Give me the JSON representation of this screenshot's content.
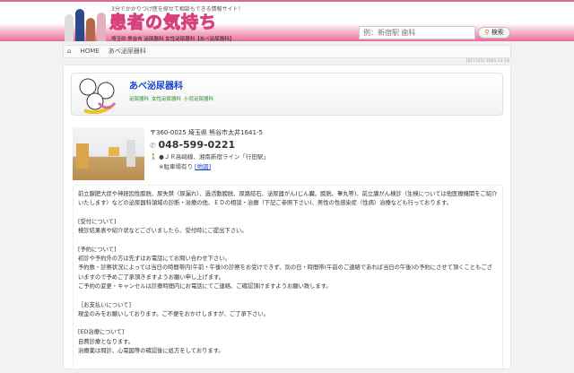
{
  "header": {
    "tagline": "3分でかかりつけ医を探せて相談もできる情報サイト！",
    "logo": "患者の気持ち",
    "subtitle": "埼玉県 熊谷市 泌尿器科 女性泌尿器科【あべ泌尿器科】",
    "search_placeholder": "例：新宿駅 歯科",
    "search_button": "検索"
  },
  "breadcrumb": {
    "home": "HOME",
    "current": "あべ泌尿器科"
  },
  "meta": {
    "date": "[017725] 2025-12-18"
  },
  "clinic": {
    "name": "あべ泌尿器科",
    "tags": [
      "泌尿器科",
      "女性泌尿器科",
      "小児泌尿器科"
    ],
    "address": "〒360-0025 埼玉県 熊谷市太井1641-5",
    "phone": "048-599-0221",
    "access": "●ＪＲ高崎線、湘南新宿ライン「行田駅」",
    "parking": "※駐車場有り",
    "map_link": "[地図]"
  },
  "description": [
    "前立腺肥大症や神経因性膀胱、尿失禁（尿漏れ）、過活動膀胱、尿路結石、泌尿器がん(じん臓、膀胱、睾丸等)、前立腺がん検診（生検については他医療機関をご紹介いたします）などの泌尿器科領域の診断・治療の他、ＥＤの相談・治療（下記ご参照下さい)、男性の性感染症（性病）治療なども行っております。",
    "[受付について]\n検診結果表や紹介状などございましたら、受付時にご提出下さい。",
    "[予約について]\n初診や予約外の方は先ずはお電話にてお問い合わせ下さい。\n予約数・診察状況によっては当日の時間帯内(午前・午後)の診察をお受けできず、別の日・時間帯(午前のご連絡であれば当日の午後)の予約にさせて頂くこともございますので予めご了承頂きますようお願い申し上げます。\nご予約の変更・キャンセルは診療時間内にお電話にてご連絡、ご確認頂けますようお願い致します。",
    "［お支払いについて]\n現金のみをお願いしております。ご不便をおかけしますが、ご了承下さい。",
    "[ED治療について]\n自費診療となります。\n治療薬は問診、心電図等の確認後に処方をしております。"
  ]
}
